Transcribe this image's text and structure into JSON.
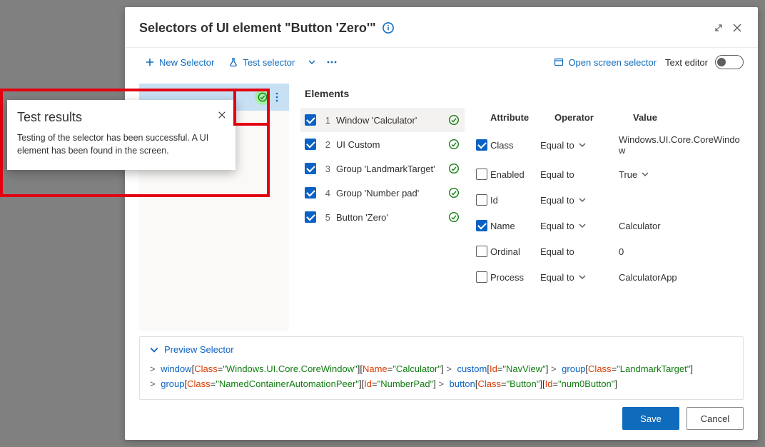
{
  "header": {
    "title": "Selectors of UI element \"Button 'Zero'\""
  },
  "toolbar": {
    "new_selector": "New Selector",
    "test_selector": "Test selector",
    "open_screen_selector": "Open screen selector",
    "text_editor": "Text editor"
  },
  "selector_list": {
    "selected": {
      "label": ""
    }
  },
  "elements": {
    "title": "Elements",
    "items": [
      {
        "idx": "1",
        "label": "Window 'Calculator'",
        "selected": true
      },
      {
        "idx": "2",
        "label": "UI Custom",
        "selected": false
      },
      {
        "idx": "3",
        "label": "Group 'LandmarkTarget'",
        "selected": false
      },
      {
        "idx": "4",
        "label": "Group 'Number pad'",
        "selected": false
      },
      {
        "idx": "5",
        "label": "Button 'Zero'",
        "selected": false
      }
    ]
  },
  "attributes": {
    "head": {
      "attr": "Attribute",
      "op": "Operator",
      "val": "Value"
    },
    "rows": [
      {
        "checked": true,
        "name": "Class",
        "op": "Equal to",
        "val": "Windows.UI.Core.CoreWindow",
        "hasCaret": true,
        "valCaret": false
      },
      {
        "checked": false,
        "name": "Enabled",
        "op": "Equal to",
        "val": "True",
        "hasCaret": false,
        "valCaret": true
      },
      {
        "checked": false,
        "name": "Id",
        "op": "Equal to",
        "val": "",
        "hasCaret": true,
        "valCaret": false
      },
      {
        "checked": true,
        "name": "Name",
        "op": "Equal to",
        "val": "Calculator",
        "hasCaret": true,
        "valCaret": false
      },
      {
        "checked": false,
        "name": "Ordinal",
        "op": "Equal to",
        "val": "0",
        "hasCaret": false,
        "valCaret": false
      },
      {
        "checked": false,
        "name": "Process",
        "op": "Equal to",
        "val": "CalculatorApp",
        "hasCaret": true,
        "valCaret": false
      }
    ]
  },
  "preview": {
    "label": "Preview Selector",
    "segments": [
      {
        "tag": "window",
        "attrs": [
          {
            "k": "Class",
            "v": "\"Windows.UI.Core.CoreWindow\""
          },
          {
            "k": "Name",
            "v": "\"Calculator\""
          }
        ]
      },
      {
        "tag": "custom",
        "attrs": [
          {
            "k": "Id",
            "v": "\"NavView\""
          }
        ]
      },
      {
        "tag": "group",
        "attrs": [
          {
            "k": "Class",
            "v": "\"LandmarkTarget\""
          }
        ]
      },
      {
        "tag": "group",
        "attrs": [
          {
            "k": "Class",
            "v": "\"NamedContainerAutomationPeer\""
          },
          {
            "k": "Id",
            "v": "\"NumberPad\""
          }
        ]
      },
      {
        "tag": "button",
        "attrs": [
          {
            "k": "Class",
            "v": "\"Button\""
          },
          {
            "k": "Id",
            "v": "\"num0Button\""
          }
        ]
      }
    ]
  },
  "buttons": {
    "save": "Save",
    "cancel": "Cancel"
  },
  "toast": {
    "title": "Test results",
    "body": "Testing of the selector has been successful. A UI element has been found in the screen."
  }
}
